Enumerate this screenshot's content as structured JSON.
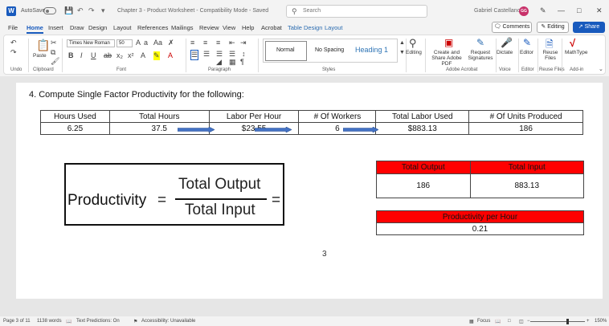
{
  "titlebar": {
    "autosave": "AutoSave",
    "doc_title": "Chapter 3 - Product Worksheet - Compatibility Mode - Saved",
    "search_placeholder": "Search",
    "user_name": "Gabriel Castellano",
    "avatar_initials": "GG"
  },
  "tabs": [
    "File",
    "Home",
    "Insert",
    "Draw",
    "Design",
    "Layout",
    "References",
    "Mailings",
    "Review",
    "View",
    "Help",
    "Acrobat",
    "Table Design",
    "Layout"
  ],
  "actions": {
    "comments": "Comments",
    "editing": "Editing",
    "share": "Share"
  },
  "ribbon": {
    "undo_label": "Undo",
    "clipboard_label": "Clipboard",
    "paste_label": "Paste",
    "font_label": "Font",
    "font_name": "Times New Roman",
    "font_size": "50",
    "paragraph_label": "Paragraph",
    "styles_label": "Styles",
    "style_normal": "Normal",
    "style_no_spacing": "No Spacing",
    "style_heading1": "Heading 1",
    "editing_label": "Editing",
    "create_share_pdf": "Create and Share Adobe PDF",
    "request_signatures": "Request Signatures",
    "adobe_label": "Adobe Acrobat",
    "dictate": "Dictate",
    "voice_label": "Voice",
    "editor": "Editor",
    "editor_label": "Editor",
    "reuse_files": "Reuse Files",
    "reuse_label": "Reuse Files",
    "mathtype": "MathType",
    "addin_label": "Add-in"
  },
  "document": {
    "question": "4.   Compute Single Factor Productivity for the following:",
    "table1": {
      "headers": [
        "Hours Used",
        "Total Hours",
        "Labor Per Hour",
        "# Of Workers",
        "Total Labor Used",
        "# Of Units Produced"
      ],
      "values": [
        "6.25",
        "37.5",
        "$23.55",
        "6",
        "$883.13",
        "186"
      ]
    },
    "formula": {
      "lhs": "Productivity",
      "eq": "=",
      "numerator": "Total Output",
      "denominator": "Total Input",
      "eq2": "="
    },
    "table2": {
      "headers": [
        "Total Output",
        "Total Input"
      ],
      "values": [
        "186",
        "883.13"
      ]
    },
    "table3": {
      "header": "Productivity per Hour",
      "value": "0.21"
    },
    "page_number": "3"
  },
  "status": {
    "page": "Page 3 of 11",
    "words": "1138 words",
    "text_predictions": "Text Predictions: On",
    "accessibility": "Accessibility: Unavailable",
    "focus": "Focus",
    "zoom": "150%"
  },
  "colors": {
    "accent": "#185abd",
    "red_header": "#ff0000",
    "arrow": "#2f5597"
  }
}
